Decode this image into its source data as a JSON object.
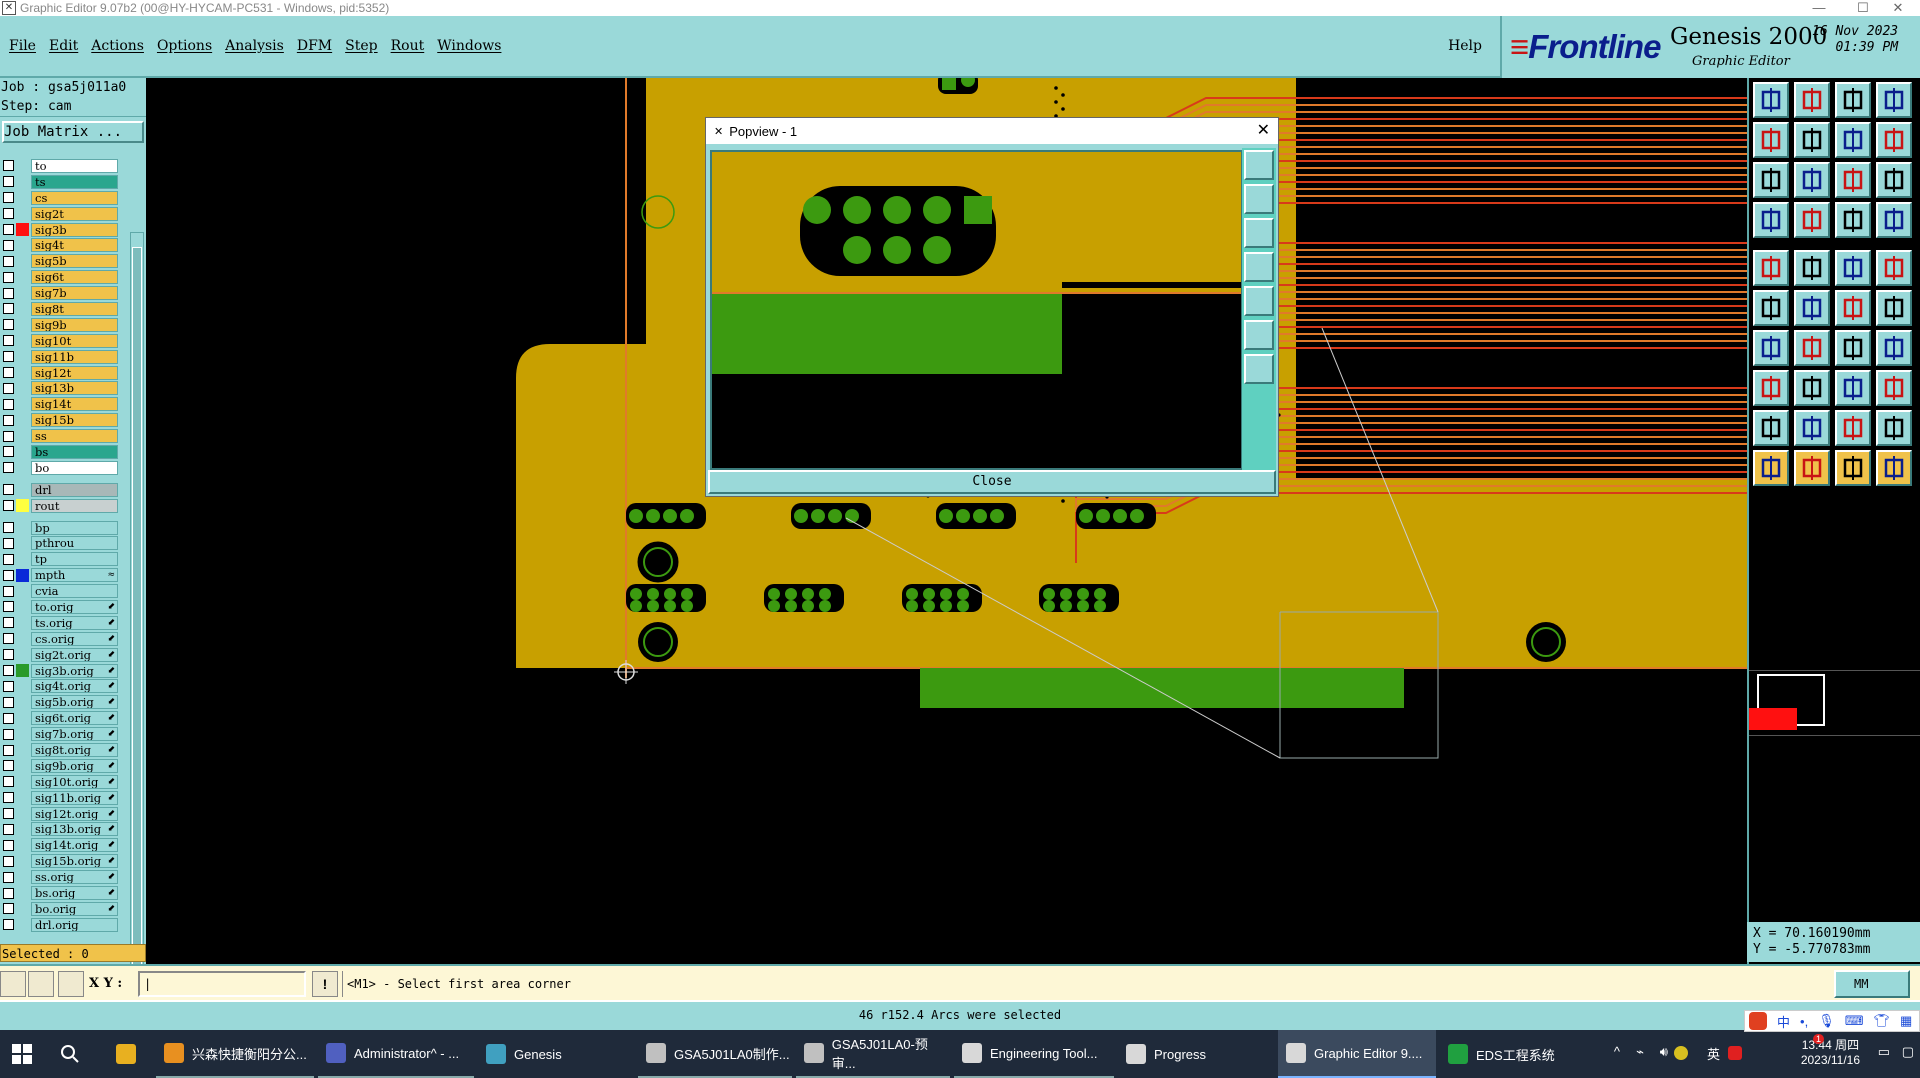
{
  "window": {
    "title": "Graphic Editor 9.07b2 (00@HY-HYCAM-PC531 - Windows, pid:5352)"
  },
  "menu": [
    "File",
    "Edit",
    "Actions",
    "Options",
    "Analysis",
    "DFM",
    "Step",
    "Rout",
    "Windows"
  ],
  "help_label": "Help",
  "brand": {
    "logo": "Frontline",
    "product": "Genesis 2000",
    "subtitle": "Graphic Editor",
    "date": "16 Nov 2023",
    "time": "01:39 PM"
  },
  "job": {
    "job": "Job : gsa5j011a0",
    "step": "Step: cam",
    "matrix_button": "Job Matrix ..."
  },
  "layers": [
    {
      "name": "to",
      "color": "#ffffff",
      "swatch": ""
    },
    {
      "name": "ts",
      "color": "#2aa68e",
      "swatch": ""
    },
    {
      "name": "cs",
      "color": "#f0c24a",
      "swatch": ""
    },
    {
      "name": "sig2t",
      "color": "#f0c24a",
      "swatch": ""
    },
    {
      "name": "sig3b",
      "color": "#f0c24a",
      "swatch": "#ff1010"
    },
    {
      "name": "sig4t",
      "color": "#f0c24a",
      "swatch": ""
    },
    {
      "name": "sig5b",
      "color": "#f0c24a",
      "swatch": ""
    },
    {
      "name": "sig6t",
      "color": "#f0c24a",
      "swatch": ""
    },
    {
      "name": "sig7b",
      "color": "#f0c24a",
      "swatch": ""
    },
    {
      "name": "sig8t",
      "color": "#f0c24a",
      "swatch": ""
    },
    {
      "name": "sig9b",
      "color": "#f0c24a",
      "swatch": ""
    },
    {
      "name": "sig10t",
      "color": "#f0c24a",
      "swatch": ""
    },
    {
      "name": "sig11b",
      "color": "#f0c24a",
      "swatch": ""
    },
    {
      "name": "sig12t",
      "color": "#f0c24a",
      "swatch": ""
    },
    {
      "name": "sig13b",
      "color": "#f0c24a",
      "swatch": ""
    },
    {
      "name": "sig14t",
      "color": "#f0c24a",
      "swatch": ""
    },
    {
      "name": "sig15b",
      "color": "#f0c24a",
      "swatch": ""
    },
    {
      "name": "ss",
      "color": "#f0c24a",
      "swatch": ""
    },
    {
      "name": "bs",
      "color": "#2aa68e",
      "swatch": ""
    },
    {
      "name": "bo",
      "color": "#ffffff",
      "swatch": ""
    },
    {
      "gap": true
    },
    {
      "name": "drl",
      "color": "#a8b8b8",
      "swatch": ""
    },
    {
      "name": "rout",
      "color": "#c8d0d0",
      "swatch": "#ffff40"
    },
    {
      "gap": true
    },
    {
      "name": "bp",
      "color": "#9ad9d9",
      "swatch": ""
    },
    {
      "name": "pthrou",
      "color": "#9ad9d9",
      "swatch": ""
    },
    {
      "name": "tp",
      "color": "#9ad9d9",
      "swatch": ""
    },
    {
      "name": "mpth",
      "color": "#9ad9d9",
      "swatch": "#0a2ad8",
      "arrow": "≈"
    },
    {
      "name": "cvia",
      "color": "#9ad9d9",
      "swatch": ""
    },
    {
      "name": "to.orig",
      "color": "#9ad9d9",
      "swatch": "",
      "arrow": "⬋"
    },
    {
      "name": "ts.orig",
      "color": "#9ad9d9",
      "swatch": "",
      "arrow": "⬋"
    },
    {
      "name": "cs.orig",
      "color": "#9ad9d9",
      "swatch": "",
      "arrow": "⬋"
    },
    {
      "name": "sig2t.orig",
      "color": "#9ad9d9",
      "swatch": "",
      "arrow": "⬋"
    },
    {
      "name": "sig3b.orig",
      "color": "#9ad9d9",
      "swatch": "#2a9a2a",
      "arrow": "⬋"
    },
    {
      "name": "sig4t.orig",
      "color": "#9ad9d9",
      "swatch": "",
      "arrow": "⬋"
    },
    {
      "name": "sig5b.orig",
      "color": "#9ad9d9",
      "swatch": "",
      "arrow": "⬋"
    },
    {
      "name": "sig6t.orig",
      "color": "#9ad9d9",
      "swatch": "",
      "arrow": "⬋"
    },
    {
      "name": "sig7b.orig",
      "color": "#9ad9d9",
      "swatch": "",
      "arrow": "⬋"
    },
    {
      "name": "sig8t.orig",
      "color": "#9ad9d9",
      "swatch": "",
      "arrow": "⬋"
    },
    {
      "name": "sig9b.orig",
      "color": "#9ad9d9",
      "swatch": "",
      "arrow": "⬋"
    },
    {
      "name": "sig10t.orig",
      "color": "#9ad9d9",
      "swatch": "",
      "arrow": "⬋"
    },
    {
      "name": "sig11b.orig",
      "color": "#9ad9d9",
      "swatch": "",
      "arrow": "⬋"
    },
    {
      "name": "sig12t.orig",
      "color": "#9ad9d9",
      "swatch": "",
      "arrow": "⬋"
    },
    {
      "name": "sig13b.orig",
      "color": "#9ad9d9",
      "swatch": "",
      "arrow": "⬋"
    },
    {
      "name": "sig14t.orig",
      "color": "#9ad9d9",
      "swatch": "",
      "arrow": "⬋"
    },
    {
      "name": "sig15b.orig",
      "color": "#9ad9d9",
      "swatch": "",
      "arrow": "⬋"
    },
    {
      "name": "ss.orig",
      "color": "#9ad9d9",
      "swatch": "",
      "arrow": "⬋"
    },
    {
      "name": "bs.orig",
      "color": "#9ad9d9",
      "swatch": "",
      "arrow": "⬋"
    },
    {
      "name": "bo.orig",
      "color": "#9ad9d9",
      "swatch": "",
      "arrow": "⬋"
    },
    {
      "name": "drl.orig",
      "color": "#9ad9d9",
      "swatch": ""
    }
  ],
  "selected": "Selected : 0",
  "popview": {
    "title": "Popview - 1",
    "close_label": "Close"
  },
  "coords": {
    "x": "X = 70.160190mm",
    "y": "Y = -5.770783mm"
  },
  "status": {
    "xy_label": "X Y :",
    "input_value": "|",
    "prompt": "<M1> - Select first area corner",
    "units": "MM"
  },
  "message": "46 r152.4 Arcs were selected",
  "taskbar": {
    "items": [
      {
        "label": "兴森快捷衡阳分公...",
        "color": "#e89020",
        "state": "open"
      },
      {
        "label": "Administrator^ - ...",
        "color": "#5060c0",
        "state": "open"
      },
      {
        "label": "Genesis",
        "color": "#40a0c0",
        "state": ""
      },
      {
        "label": "GSA5J01LA0制作...",
        "color": "#c0c0c0",
        "state": "open"
      },
      {
        "label": "GSA5J01LA0-预审...",
        "color": "#c0c0c0",
        "state": "open"
      },
      {
        "label": "Engineering Tool...",
        "color": "#d8d8d8",
        "state": "open"
      },
      {
        "label": "Progress",
        "color": "#d8d8d8",
        "state": ""
      },
      {
        "label": "Graphic Editor 9....",
        "color": "#d8d8d8",
        "state": "active"
      },
      {
        "label": "EDS工程系统",
        "color": "#20a040",
        "state": ""
      }
    ],
    "ime": "英",
    "ime_bar": "中",
    "clock_time": "13:44 周四",
    "clock_date": "2023/11/16",
    "notification_count": "1"
  },
  "colors": {
    "teal": "#9ad9d9",
    "copper": "#c8a000",
    "pad_green": "#3c9a10",
    "trace_orange": "#e07a2a",
    "accent_red": "#ff1010"
  },
  "toolbar_icons": [
    "zoom-home-icon",
    "zoom-in-icon",
    "zoom-out-icon",
    "fit-icon",
    "pan-left-icon",
    "pan-right-icon",
    "redraw-icon",
    "snap-icon",
    "zoom-window-icon",
    "zoom-fit-icon",
    "scale-icon",
    "help-icon",
    "measure-icon",
    "snap-point-icon",
    "net-icon",
    "ruler-icon",
    "select-icon",
    "line-icon",
    "pad-icon",
    "dot-icon",
    "node-icon",
    "cross-icon",
    "move-icon",
    "add-icon",
    "angle-icon",
    "slash-icon",
    "arc-icon",
    "text-icon",
    "pin-icon",
    "dash-icon",
    "align-icon",
    "shape-icon",
    "triangle-icon",
    "polygon-icon",
    "dim-icon",
    "outline-icon",
    "pointer-icon",
    "pointer-select-icon",
    "pointer-edit-icon",
    "pointer-drag-icon"
  ]
}
